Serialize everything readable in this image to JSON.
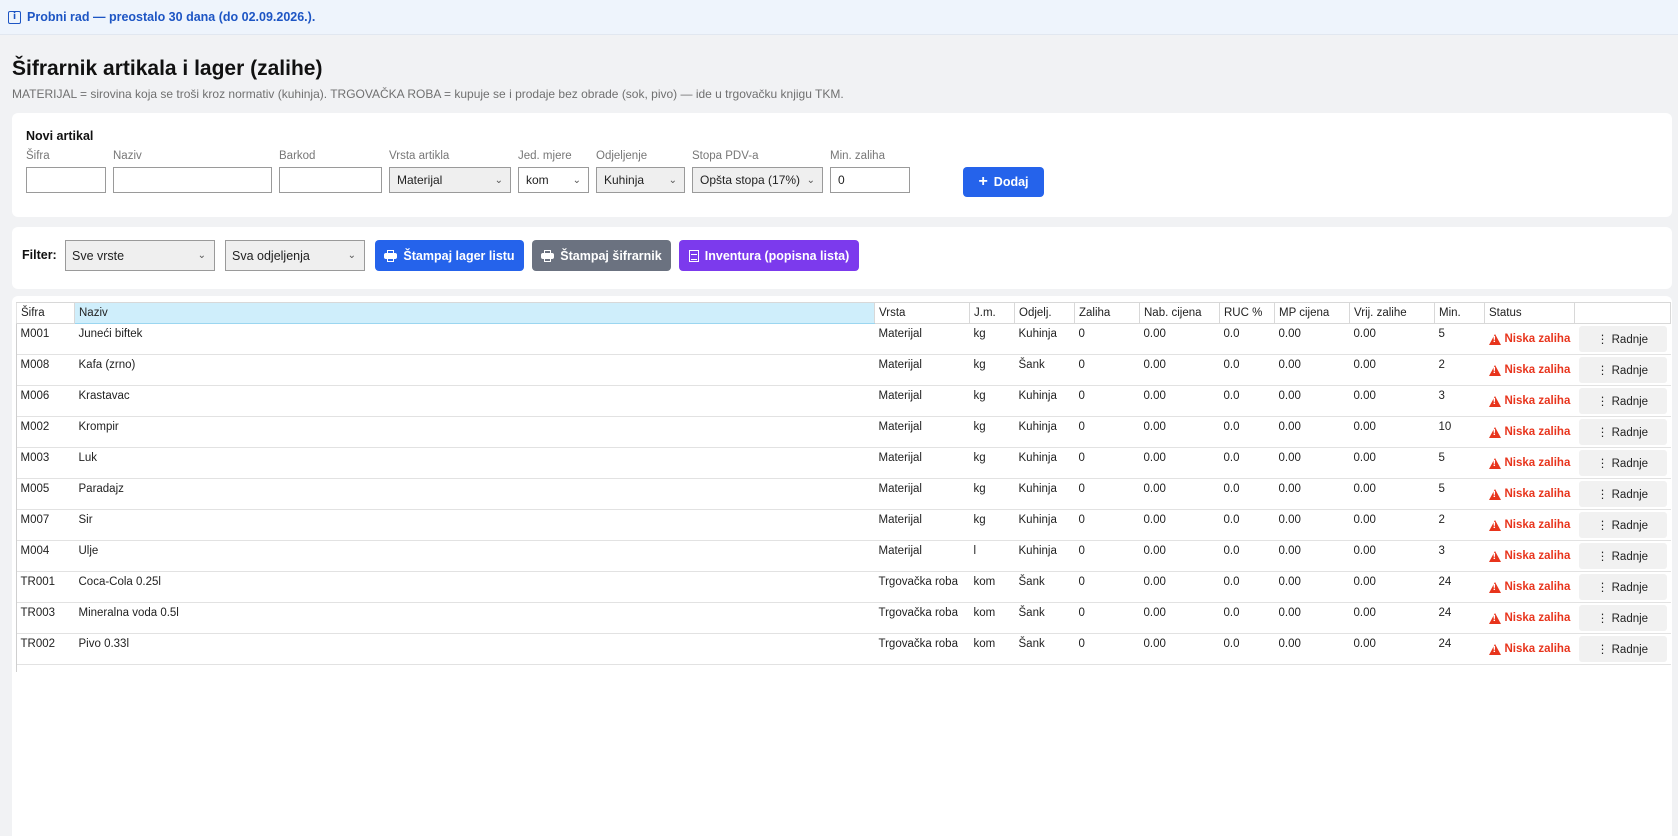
{
  "trial": {
    "icon": "info-icon",
    "text": "Probni rad — preostalo 30 dana (do 02.09.2026.)."
  },
  "page": {
    "title": "Šifrarnik artikala i lager (zalihe)",
    "subtitle": "MATERIJAL = sirovina koja se troši kroz normativ (kuhinja). TRGOVAČKA ROBA = kupuje se i prodaje bez obrade (sok, pivo) — ide u trgovačku knjigu TKM."
  },
  "new_article": {
    "title": "Novi artikal",
    "sifra_label": "Šifra",
    "sifra_value": "",
    "naziv_label": "Naziv",
    "naziv_value": "",
    "barkod_label": "Barkod",
    "barkod_value": "",
    "vrsta_label": "Vrsta artikla",
    "vrsta_value": "Materijal",
    "jm_label": "Jed. mjere",
    "jm_value": "kom",
    "odjeljenje_label": "Odjeljenje",
    "odjeljenje_value": "Kuhinja",
    "pdv_label": "Stopa PDV-a",
    "pdv_value": "Opšta stopa (17%)",
    "min_label": "Min. zaliha",
    "min_value": "0",
    "add_button": "Dodaj"
  },
  "filter": {
    "label": "Filter:",
    "vrste_value": "Sve vrste",
    "odjeljenja_value": "Sva odjeljenja",
    "print_lager": "Štampaj lager listu",
    "print_sifrarnik": "Štampaj šifrarnik",
    "inventura": "Inventura (popisna lista)"
  },
  "colors": {
    "primary": "#2563eb",
    "secondary": "#6b7280",
    "purple": "#7c3aed",
    "warning": "#e8341c",
    "banner_text": "#1d55c4"
  },
  "table": {
    "headers": [
      "Šifra",
      "Naziv",
      "Vrsta",
      "J.m.",
      "Odjelj.",
      "Zaliha",
      "Nab. cijena",
      "RUC %",
      "MP cijena",
      "Vrij. zalihe",
      "Min.",
      "Status",
      ""
    ],
    "rows": [
      [
        "M001",
        "Juneći biftek",
        "Materijal",
        "kg",
        "Kuhinja",
        "0",
        "0.00",
        "0.0",
        "0.00",
        "0.00",
        "5",
        "Niska zaliha",
        "⋮ Radnje"
      ],
      [
        "M008",
        "Kafa (zrno)",
        "Materijal",
        "kg",
        "Šank",
        "0",
        "0.00",
        "0.0",
        "0.00",
        "0.00",
        "2",
        "Niska zaliha",
        "⋮ Radnje"
      ],
      [
        "M006",
        "Krastavac",
        "Materijal",
        "kg",
        "Kuhinja",
        "0",
        "0.00",
        "0.0",
        "0.00",
        "0.00",
        "3",
        "Niska zaliha",
        "⋮ Radnje"
      ],
      [
        "M002",
        "Krompir",
        "Materijal",
        "kg",
        "Kuhinja",
        "0",
        "0.00",
        "0.0",
        "0.00",
        "0.00",
        "10",
        "Niska zaliha",
        "⋮ Radnje"
      ],
      [
        "M003",
        "Luk",
        "Materijal",
        "kg",
        "Kuhinja",
        "0",
        "0.00",
        "0.0",
        "0.00",
        "0.00",
        "5",
        "Niska zaliha",
        "⋮ Radnje"
      ],
      [
        "M005",
        "Paradajz",
        "Materijal",
        "kg",
        "Kuhinja",
        "0",
        "0.00",
        "0.0",
        "0.00",
        "0.00",
        "5",
        "Niska zaliha",
        "⋮ Radnje"
      ],
      [
        "M007",
        "Sir",
        "Materijal",
        "kg",
        "Kuhinja",
        "0",
        "0.00",
        "0.0",
        "0.00",
        "0.00",
        "2",
        "Niska zaliha",
        "⋮ Radnje"
      ],
      [
        "M004",
        "Ulje",
        "Materijal",
        "l",
        "Kuhinja",
        "0",
        "0.00",
        "0.0",
        "0.00",
        "0.00",
        "3",
        "Niska zaliha",
        "⋮ Radnje"
      ],
      [
        "TR001",
        "Coca-Cola 0.25l",
        "Trgovačka roba",
        "kom",
        "Šank",
        "0",
        "0.00",
        "0.0",
        "0.00",
        "0.00",
        "24",
        "Niska zaliha",
        "⋮ Radnje"
      ],
      [
        "TR003",
        "Mineralna voda 0.5l",
        "Trgovačka roba",
        "kom",
        "Šank",
        "0",
        "0.00",
        "0.0",
        "0.00",
        "0.00",
        "24",
        "Niska zaliha",
        "⋮ Radnje"
      ],
      [
        "TR002",
        "Pivo 0.33l",
        "Trgovačka roba",
        "kom",
        "Šank",
        "0",
        "0.00",
        "0.0",
        "0.00",
        "0.00",
        "24",
        "Niska zaliha",
        "⋮ Radnje"
      ]
    ]
  }
}
